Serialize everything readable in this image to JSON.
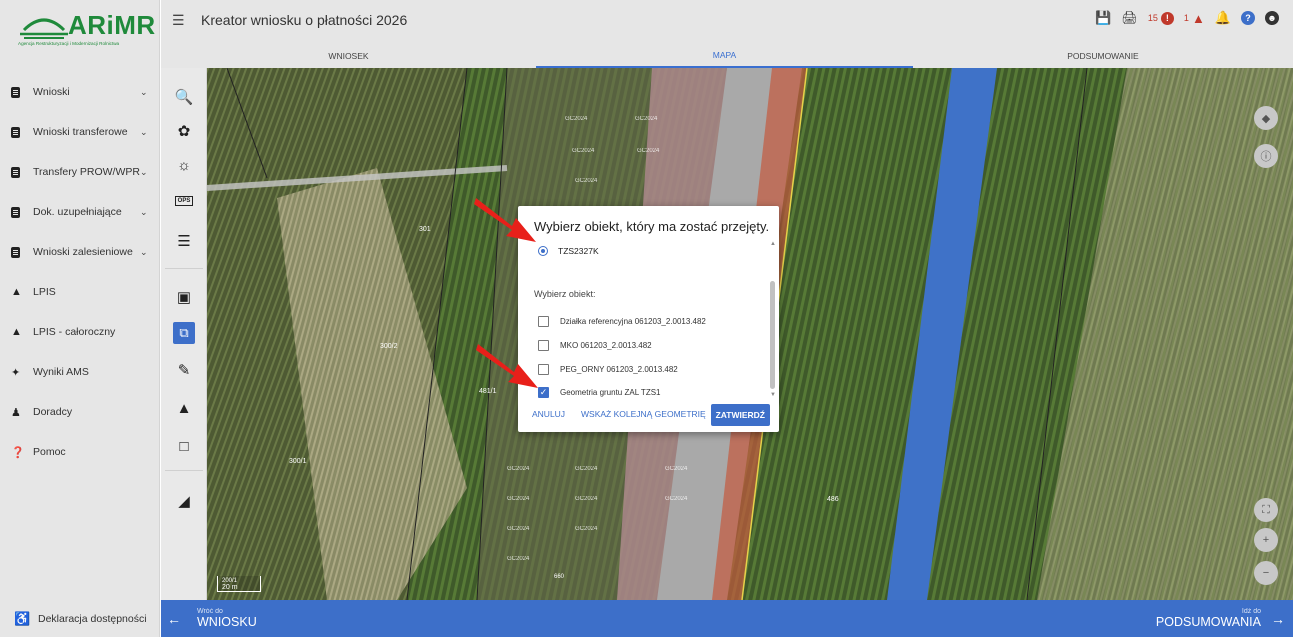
{
  "logo": {
    "text": "ARiMR",
    "subtitle": "Agencja Restrukturyzacji i Modernizacji Rolnictwa"
  },
  "header": {
    "title": "Kreator wniosku o płatności 2026",
    "errors_count": "15",
    "warnings_count": "1"
  },
  "tabs": [
    {
      "label": "WNIOSEK"
    },
    {
      "label": "MAPA"
    },
    {
      "label": "PODSUMOWANIE"
    }
  ],
  "sidebar": {
    "items": [
      {
        "label": "Wnioski",
        "icon": "document-icon"
      },
      {
        "label": "Wnioski transferowe",
        "icon": "document-icon"
      },
      {
        "label": "Transfery PROW/WPR",
        "icon": "document-icon"
      },
      {
        "label": "Dok. uzupełniające",
        "icon": "document-icon"
      },
      {
        "label": "Wnioski zalesieniowe",
        "icon": "document-icon"
      },
      {
        "label": "LPIS",
        "icon": "mountain-icon"
      },
      {
        "label": "LPIS - całoroczny",
        "icon": "mountain-icon"
      },
      {
        "label": "Wyniki AMS",
        "icon": "satellite-icon"
      },
      {
        "label": "Doradcy",
        "icon": "person-icon"
      },
      {
        "label": "Pomoc",
        "icon": "help-icon"
      }
    ],
    "footer": "Deklaracja dostępności"
  },
  "tools": {
    "ops_label": "OPS"
  },
  "map": {
    "scale_label": "20 m",
    "parcel_labels": [
      "301",
      "300/2",
      "300/1",
      "481/1",
      "486",
      "660",
      "200/1"
    ],
    "tag_label": "GC2024"
  },
  "dialog": {
    "title": "Wybierz obiekt, który ma zostać przejęty.",
    "radio_value": "TZS2327K",
    "section_label": "Wybierz obiekt:",
    "options": [
      {
        "label": "Działka referencyjna 061203_2.0013.482",
        "checked": false
      },
      {
        "label": "MKO 061203_2.0013.482",
        "checked": false
      },
      {
        "label": "PEG_ORNY 061203_2.0013.482",
        "checked": false
      },
      {
        "label": "Geometria gruntu ZAL TZS1",
        "checked": true
      }
    ],
    "cancel_label": "ANULUJ",
    "next_geometry_label": "WSKAŻ KOLEJNĄ GEOMETRIĘ",
    "confirm_label": "ZATWIERDŹ"
  },
  "bottombar": {
    "back_caption": "Wróć do",
    "back_label": "WNIOSKU",
    "next_caption": "Idź do",
    "next_label": "PODSUMOWANIA"
  },
  "colors": {
    "accent": "#3d6fc9",
    "brand_green": "#1f8a3b",
    "error": "#c0392b",
    "annotation_arrow": "#e8201a"
  }
}
